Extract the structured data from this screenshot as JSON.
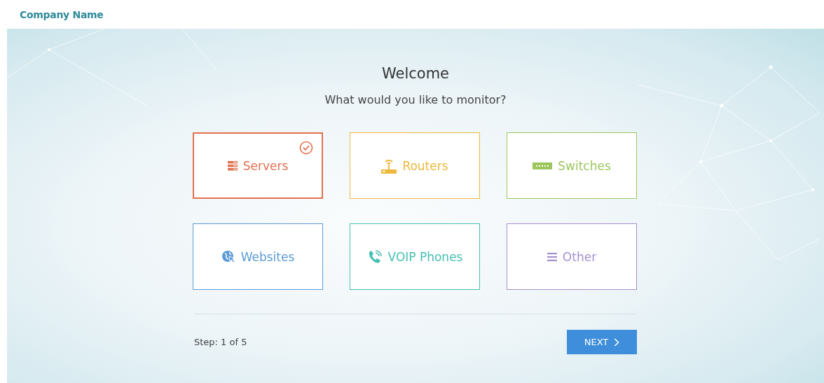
{
  "header": {
    "company": "Company Name"
  },
  "wizard": {
    "title": "Welcome",
    "question": "What would you like to monitor?",
    "options": [
      {
        "label": "Servers",
        "kind": "servers",
        "color": "#e2714f",
        "selected": true
      },
      {
        "label": "Routers",
        "kind": "routers",
        "color": "#ecb93c",
        "selected": false
      },
      {
        "label": "Switches",
        "kind": "switches",
        "color": "#9cc65c",
        "selected": false
      },
      {
        "label": "Websites",
        "kind": "websites",
        "color": "#5b9bd5",
        "selected": false
      },
      {
        "label": "VOIP Phones",
        "kind": "phones",
        "color": "#45bfb3",
        "selected": false
      },
      {
        "label": "Other",
        "kind": "other",
        "color": "#a58fd0",
        "selected": false
      }
    ],
    "step": "Step: 1 of 5",
    "next": "NEXT"
  }
}
